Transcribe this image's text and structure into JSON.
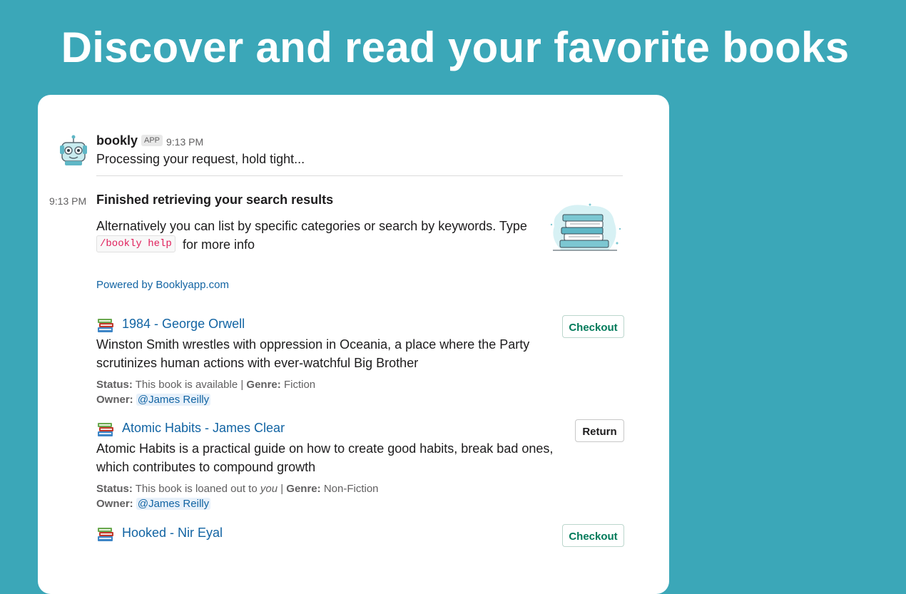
{
  "hero": {
    "title": "Discover and read your favorite books"
  },
  "message": {
    "sender": "bookly",
    "badge": "APP",
    "time": "9:13 PM",
    "text": "Processing your request, hold tight..."
  },
  "result": {
    "time": "9:13 PM",
    "heading": "Finished retrieving your search results",
    "alt_text_1": "Alternatively you can list by specific categories or search by keywords. Type",
    "command": "/bookly help",
    "alt_text_2": "for more info",
    "powered_by": "Powered by Booklyapp.com"
  },
  "books": [
    {
      "title": "1984 - George Orwell",
      "description": "Winston Smith wrestles with oppression in Oceania, a place where the Party scrutinizes human actions with ever-watchful Big Brother",
      "status_label": "Status:",
      "status_pre": "This book is available",
      "status_em": "",
      "genre_label": "Genre:",
      "genre": "Fiction",
      "owner_label": "Owner:",
      "owner": "@James Reilly",
      "action": "Checkout"
    },
    {
      "title": "Atomic Habits - James Clear",
      "description": "Atomic Habits is a practical guide on how to create good habits, break bad ones, which contributes to compound growth",
      "status_label": "Status:",
      "status_pre": "This book is loaned out to ",
      "status_em": "you",
      "genre_label": "Genre:",
      "genre": "Non-Fiction",
      "owner_label": "Owner:",
      "owner": "@James Reilly",
      "action": "Return"
    },
    {
      "title": "Hooked - Nir Eyal",
      "action": "Checkout"
    }
  ],
  "icons": {
    "avatar": "bookly-robot-avatar-icon",
    "books": "books-emoji-icon",
    "illustration": "book-stack-illustration"
  },
  "colors": {
    "background": "#3ba7b8",
    "link": "#1264a3",
    "checkout": "#007a5a",
    "code": "#e01e5a"
  }
}
